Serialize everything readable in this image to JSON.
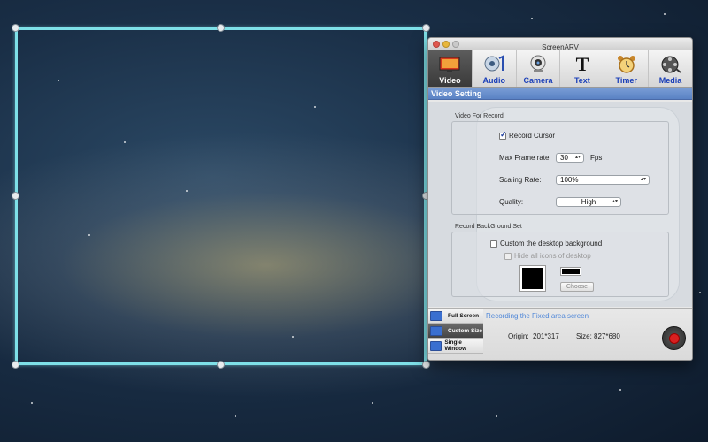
{
  "window": {
    "title": "ScreenARV"
  },
  "toolbar": {
    "items": [
      {
        "label": "Video",
        "icon": "video-icon",
        "active": true
      },
      {
        "label": "Audio",
        "icon": "audio-icon",
        "active": false
      },
      {
        "label": "Camera",
        "icon": "camera-icon",
        "active": false
      },
      {
        "label": "Text",
        "icon": "text-icon",
        "active": false
      },
      {
        "label": "Timer",
        "icon": "timer-icon",
        "active": false
      },
      {
        "label": "Media",
        "icon": "media-icon",
        "active": false
      }
    ]
  },
  "video_setting": {
    "header": "Video Setting",
    "video_for_record": {
      "group_label": "Video For Record",
      "record_cursor": {
        "label": "Record Cursor",
        "checked": true
      },
      "max_frame_rate": {
        "label": "Max Frame rate:",
        "value": "30",
        "unit": "Fps"
      },
      "scaling_rate": {
        "label": "Scaling Rate:",
        "value": "100%"
      },
      "quality": {
        "label": "Quality:",
        "value": "High"
      }
    },
    "record_background": {
      "group_label": "Record BackGround Set",
      "custom_desktop": {
        "label": "Custom the desktop background",
        "checked": false
      },
      "hide_icons": {
        "label": "Hide all icons of desktop",
        "checked": false,
        "enabled": false
      },
      "swatch_color": "#000000",
      "choose_label": "Choose"
    }
  },
  "modes": [
    {
      "label": "Full Screen",
      "active": false
    },
    {
      "label": "Custom Size",
      "active": true
    },
    {
      "label": "Single Window",
      "active": false
    }
  ],
  "status": {
    "message": "Recording the Fixed area screen",
    "origin_label": "Origin:",
    "origin_value": "201*317",
    "size_label": "Size:",
    "size_value": "827*680"
  },
  "colors": {
    "selection": "#7ee0e8",
    "accent": "#1a3fb8",
    "record": "#d82020"
  }
}
